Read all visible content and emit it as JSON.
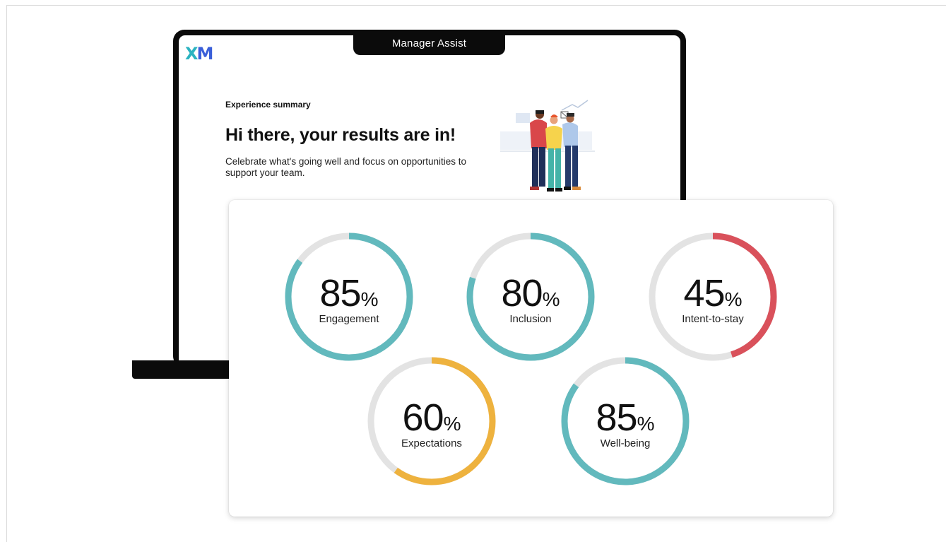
{
  "laptop": {
    "title": "Manager Assist",
    "logo": "XM",
    "eyebrow": "Experience summary",
    "headline": "Hi there, your results are in!",
    "subtext": "Celebrate what's going well and focus on opportunities to support your team."
  },
  "colors": {
    "teal": "#62b9bd",
    "red": "#d9515b",
    "yellow": "#eeb23e",
    "track": "#e3e3e3"
  },
  "metrics": [
    {
      "value": "85",
      "unit": "%",
      "label": "Engagement",
      "fraction": 0.85,
      "color": "#62b9bd"
    },
    {
      "value": "80",
      "unit": "%",
      "label": "Inclusion",
      "fraction": 0.8,
      "color": "#62b9bd"
    },
    {
      "value": "45",
      "unit": "%",
      "label": "Intent-to-stay",
      "fraction": 0.45,
      "color": "#d9515b"
    },
    {
      "value": "60",
      "unit": "%",
      "label": "Expectations",
      "fraction": 0.6,
      "color": "#eeb23e"
    },
    {
      "value": "85",
      "unit": "%",
      "label": "Well-being",
      "fraction": 0.85,
      "color": "#62b9bd"
    }
  ]
}
